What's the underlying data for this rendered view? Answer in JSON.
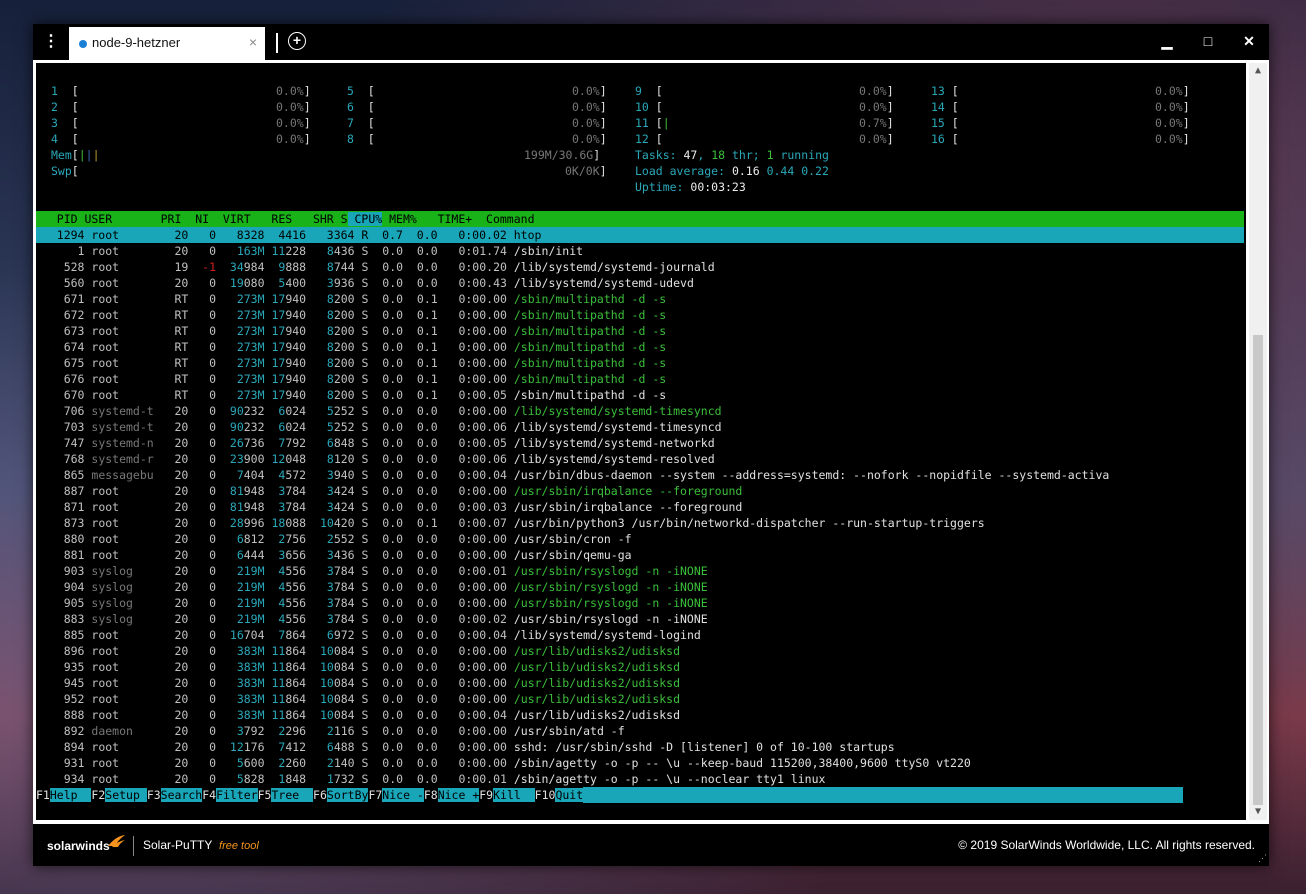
{
  "tab": {
    "title": "node-9-hetzner",
    "close": "×"
  },
  "controls": {
    "menu": "⋮",
    "add": "+",
    "minimize": "▁",
    "maximize": "□",
    "close": "✕"
  },
  "meters": [
    [
      "1 [",
      "0.0%]",
      "5 [",
      "0.0%]",
      "9 [",
      "0.0%]",
      "13 [",
      "0.0%]"
    ],
    [
      "2 [",
      "0.0%]",
      "6 [",
      "0.0%]",
      "10 [",
      "0.0%]",
      "14 [",
      "0.0%]"
    ],
    [
      "3 [",
      "0.0%]",
      "7 [",
      "0.0%]",
      "11 [|",
      "0.7%]",
      "15 [",
      "0.0%]"
    ],
    [
      "4 [",
      "0.0%]",
      "8 [",
      "0.0%]",
      "12 [",
      "0.0%]",
      "16 [",
      "0.0%]"
    ]
  ],
  "mem": {
    "label": "Mem[",
    "bars": "|||",
    "value": "199M/30.6G]"
  },
  "swp": {
    "label": "Swp[",
    "value": "0K/0K]"
  },
  "tasks": {
    "label": "Tasks: ",
    "count": "47",
    "sep": ", ",
    "thr": "18",
    "thr_label": " thr; ",
    "running": "1",
    "running_label": " running"
  },
  "load": {
    "label": "Load average: ",
    "l1": "0.16",
    "l5": "0.44",
    "l15": "0.22"
  },
  "uptime": {
    "label": "Uptime: ",
    "value": "00:03:23"
  },
  "columns": {
    "pid": "  PID",
    "user": " USER     ",
    "pri": "  PRI",
    "ni": "  NI",
    "virt": "  VIRT",
    "res": "   RES",
    "shr": "   SHR",
    "s": " S",
    "cpu": " CPU%",
    "mem": " MEM%",
    "time": "   TIME+ ",
    "cmd": " Command"
  },
  "processes": [
    {
      "pid": "1294",
      "user": "root",
      "pri": "20",
      "ni": "0",
      "virt": "8328",
      "res": "4416",
      "shr": "3364",
      "s": "R",
      "cpu": "0.7",
      "mem": "0.0",
      "time": "0:00.02",
      "cmd": "htop",
      "sel": true
    },
    {
      "pid": "1",
      "user": "root",
      "pri": "20",
      "ni": "0",
      "virt": "163M",
      "res": "11228",
      "shr": "8436",
      "s": "S",
      "cpu": "0.0",
      "mem": "0.0",
      "time": "0:01.74",
      "cmd": "/sbin/init"
    },
    {
      "pid": "528",
      "user": "root",
      "pri": "19",
      "ni": "-1",
      "virt": "34984",
      "res": "9888",
      "shr": "8744",
      "s": "S",
      "cpu": "0.0",
      "mem": "0.0",
      "time": "0:00.20",
      "cmd": "/lib/systemd/systemd-journald"
    },
    {
      "pid": "560",
      "user": "root",
      "pri": "20",
      "ni": "0",
      "virt": "19080",
      "res": "5400",
      "shr": "3936",
      "s": "S",
      "cpu": "0.0",
      "mem": "0.0",
      "time": "0:00.43",
      "cmd": "/lib/systemd/systemd-udevd"
    },
    {
      "pid": "671",
      "user": "root",
      "pri": "RT",
      "ni": "0",
      "virt": "273M",
      "res": "17940",
      "shr": "8200",
      "s": "S",
      "cpu": "0.0",
      "mem": "0.1",
      "time": "0:00.00",
      "cmd": "/sbin/multipathd -d -s",
      "thread": true
    },
    {
      "pid": "672",
      "user": "root",
      "pri": "RT",
      "ni": "0",
      "virt": "273M",
      "res": "17940",
      "shr": "8200",
      "s": "S",
      "cpu": "0.0",
      "mem": "0.1",
      "time": "0:00.00",
      "cmd": "/sbin/multipathd -d -s",
      "thread": true
    },
    {
      "pid": "673",
      "user": "root",
      "pri": "RT",
      "ni": "0",
      "virt": "273M",
      "res": "17940",
      "shr": "8200",
      "s": "S",
      "cpu": "0.0",
      "mem": "0.1",
      "time": "0:00.00",
      "cmd": "/sbin/multipathd -d -s",
      "thread": true
    },
    {
      "pid": "674",
      "user": "root",
      "pri": "RT",
      "ni": "0",
      "virt": "273M",
      "res": "17940",
      "shr": "8200",
      "s": "S",
      "cpu": "0.0",
      "mem": "0.1",
      "time": "0:00.00",
      "cmd": "/sbin/multipathd -d -s",
      "thread": true
    },
    {
      "pid": "675",
      "user": "root",
      "pri": "RT",
      "ni": "0",
      "virt": "273M",
      "res": "17940",
      "shr": "8200",
      "s": "S",
      "cpu": "0.0",
      "mem": "0.1",
      "time": "0:00.00",
      "cmd": "/sbin/multipathd -d -s",
      "thread": true
    },
    {
      "pid": "676",
      "user": "root",
      "pri": "RT",
      "ni": "0",
      "virt": "273M",
      "res": "17940",
      "shr": "8200",
      "s": "S",
      "cpu": "0.0",
      "mem": "0.1",
      "time": "0:00.00",
      "cmd": "/sbin/multipathd -d -s",
      "thread": true
    },
    {
      "pid": "670",
      "user": "root",
      "pri": "RT",
      "ni": "0",
      "virt": "273M",
      "res": "17940",
      "shr": "8200",
      "s": "S",
      "cpu": "0.0",
      "mem": "0.1",
      "time": "0:00.05",
      "cmd": "/sbin/multipathd -d -s"
    },
    {
      "pid": "706",
      "user": "systemd-t",
      "pri": "20",
      "ni": "0",
      "virt": "90232",
      "res": "6024",
      "shr": "5252",
      "s": "S",
      "cpu": "0.0",
      "mem": "0.0",
      "time": "0:00.00",
      "cmd": "/lib/systemd/systemd-timesyncd",
      "thread": true,
      "dimuser": true
    },
    {
      "pid": "703",
      "user": "systemd-t",
      "pri": "20",
      "ni": "0",
      "virt": "90232",
      "res": "6024",
      "shr": "5252",
      "s": "S",
      "cpu": "0.0",
      "mem": "0.0",
      "time": "0:00.06",
      "cmd": "/lib/systemd/systemd-timesyncd",
      "dimuser": true
    },
    {
      "pid": "747",
      "user": "systemd-n",
      "pri": "20",
      "ni": "0",
      "virt": "26736",
      "res": "7792",
      "shr": "6848",
      "s": "S",
      "cpu": "0.0",
      "mem": "0.0",
      "time": "0:00.05",
      "cmd": "/lib/systemd/systemd-networkd",
      "dimuser": true
    },
    {
      "pid": "768",
      "user": "systemd-r",
      "pri": "20",
      "ni": "0",
      "virt": "23900",
      "res": "12048",
      "shr": "8120",
      "s": "S",
      "cpu": "0.0",
      "mem": "0.0",
      "time": "0:00.06",
      "cmd": "/lib/systemd/systemd-resolved",
      "dimuser": true
    },
    {
      "pid": "865",
      "user": "messagebu",
      "pri": "20",
      "ni": "0",
      "virt": "7404",
      "res": "4572",
      "shr": "3940",
      "s": "S",
      "cpu": "0.0",
      "mem": "0.0",
      "time": "0:00.04",
      "cmd": "/usr/bin/dbus-daemon --system --address=systemd: --nofork --nopidfile --systemd-activa",
      "dimuser": true
    },
    {
      "pid": "887",
      "user": "root",
      "pri": "20",
      "ni": "0",
      "virt": "81948",
      "res": "3784",
      "shr": "3424",
      "s": "S",
      "cpu": "0.0",
      "mem": "0.0",
      "time": "0:00.00",
      "cmd": "/usr/sbin/irqbalance --foreground",
      "thread": true
    },
    {
      "pid": "871",
      "user": "root",
      "pri": "20",
      "ni": "0",
      "virt": "81948",
      "res": "3784",
      "shr": "3424",
      "s": "S",
      "cpu": "0.0",
      "mem": "0.0",
      "time": "0:00.03",
      "cmd": "/usr/sbin/irqbalance --foreground"
    },
    {
      "pid": "873",
      "user": "root",
      "pri": "20",
      "ni": "0",
      "virt": "28996",
      "res": "18088",
      "shr": "10420",
      "s": "S",
      "cpu": "0.0",
      "mem": "0.1",
      "time": "0:00.07",
      "cmd": "/usr/bin/python3 /usr/bin/networkd-dispatcher --run-startup-triggers"
    },
    {
      "pid": "880",
      "user": "root",
      "pri": "20",
      "ni": "0",
      "virt": "6812",
      "res": "2756",
      "shr": "2552",
      "s": "S",
      "cpu": "0.0",
      "mem": "0.0",
      "time": "0:00.00",
      "cmd": "/usr/sbin/cron -f"
    },
    {
      "pid": "881",
      "user": "root",
      "pri": "20",
      "ni": "0",
      "virt": "6444",
      "res": "3656",
      "shr": "3436",
      "s": "S",
      "cpu": "0.0",
      "mem": "0.0",
      "time": "0:00.00",
      "cmd": "/usr/sbin/qemu-ga"
    },
    {
      "pid": "903",
      "user": "syslog",
      "pri": "20",
      "ni": "0",
      "virt": "219M",
      "res": "4556",
      "shr": "3784",
      "s": "S",
      "cpu": "0.0",
      "mem": "0.0",
      "time": "0:00.01",
      "cmd": "/usr/sbin/rsyslogd -n -iNONE",
      "thread": true,
      "dimuser": true
    },
    {
      "pid": "904",
      "user": "syslog",
      "pri": "20",
      "ni": "0",
      "virt": "219M",
      "res": "4556",
      "shr": "3784",
      "s": "S",
      "cpu": "0.0",
      "mem": "0.0",
      "time": "0:00.00",
      "cmd": "/usr/sbin/rsyslogd -n -iNONE",
      "thread": true,
      "dimuser": true
    },
    {
      "pid": "905",
      "user": "syslog",
      "pri": "20",
      "ni": "0",
      "virt": "219M",
      "res": "4556",
      "shr": "3784",
      "s": "S",
      "cpu": "0.0",
      "mem": "0.0",
      "time": "0:00.00",
      "cmd": "/usr/sbin/rsyslogd -n -iNONE",
      "thread": true,
      "dimuser": true
    },
    {
      "pid": "883",
      "user": "syslog",
      "pri": "20",
      "ni": "0",
      "virt": "219M",
      "res": "4556",
      "shr": "3784",
      "s": "S",
      "cpu": "0.0",
      "mem": "0.0",
      "time": "0:00.02",
      "cmd": "/usr/sbin/rsyslogd -n -iNONE",
      "dimuser": true
    },
    {
      "pid": "885",
      "user": "root",
      "pri": "20",
      "ni": "0",
      "virt": "16704",
      "res": "7864",
      "shr": "6972",
      "s": "S",
      "cpu": "0.0",
      "mem": "0.0",
      "time": "0:00.04",
      "cmd": "/lib/systemd/systemd-logind"
    },
    {
      "pid": "896",
      "user": "root",
      "pri": "20",
      "ni": "0",
      "virt": "383M",
      "res": "11864",
      "shr": "10084",
      "s": "S",
      "cpu": "0.0",
      "mem": "0.0",
      "time": "0:00.00",
      "cmd": "/usr/lib/udisks2/udisksd",
      "thread": true
    },
    {
      "pid": "935",
      "user": "root",
      "pri": "20",
      "ni": "0",
      "virt": "383M",
      "res": "11864",
      "shr": "10084",
      "s": "S",
      "cpu": "0.0",
      "mem": "0.0",
      "time": "0:00.00",
      "cmd": "/usr/lib/udisks2/udisksd",
      "thread": true
    },
    {
      "pid": "945",
      "user": "root",
      "pri": "20",
      "ni": "0",
      "virt": "383M",
      "res": "11864",
      "shr": "10084",
      "s": "S",
      "cpu": "0.0",
      "mem": "0.0",
      "time": "0:00.00",
      "cmd": "/usr/lib/udisks2/udisksd",
      "thread": true
    },
    {
      "pid": "952",
      "user": "root",
      "pri": "20",
      "ni": "0",
      "virt": "383M",
      "res": "11864",
      "shr": "10084",
      "s": "S",
      "cpu": "0.0",
      "mem": "0.0",
      "time": "0:00.00",
      "cmd": "/usr/lib/udisks2/udisksd",
      "thread": true
    },
    {
      "pid": "888",
      "user": "root",
      "pri": "20",
      "ni": "0",
      "virt": "383M",
      "res": "11864",
      "shr": "10084",
      "s": "S",
      "cpu": "0.0",
      "mem": "0.0",
      "time": "0:00.04",
      "cmd": "/usr/lib/udisks2/udisksd"
    },
    {
      "pid": "892",
      "user": "daemon",
      "pri": "20",
      "ni": "0",
      "virt": "3792",
      "res": "2296",
      "shr": "2116",
      "s": "S",
      "cpu": "0.0",
      "mem": "0.0",
      "time": "0:00.00",
      "cmd": "/usr/sbin/atd -f",
      "dimuser": true
    },
    {
      "pid": "894",
      "user": "root",
      "pri": "20",
      "ni": "0",
      "virt": "12176",
      "res": "7412",
      "shr": "6488",
      "s": "S",
      "cpu": "0.0",
      "mem": "0.0",
      "time": "0:00.00",
      "cmd": "sshd: /usr/sbin/sshd -D [listener] 0 of 10-100 startups"
    },
    {
      "pid": "931",
      "user": "root",
      "pri": "20",
      "ni": "0",
      "virt": "5600",
      "res": "2260",
      "shr": "2140",
      "s": "S",
      "cpu": "0.0",
      "mem": "0.0",
      "time": "0:00.00",
      "cmd": "/sbin/agetty -o -p -- \\u --keep-baud 115200,38400,9600 ttyS0 vt220"
    },
    {
      "pid": "934",
      "user": "root",
      "pri": "20",
      "ni": "0",
      "virt": "5828",
      "res": "1848",
      "shr": "1732",
      "s": "S",
      "cpu": "0.0",
      "mem": "0.0",
      "time": "0:00.01",
      "cmd": "/sbin/agetty -o -p -- \\u --noclear tty1 linux"
    }
  ],
  "fkeys": [
    {
      "key": "F1",
      "label": "Help  "
    },
    {
      "key": "F2",
      "label": "Setup "
    },
    {
      "key": "F3",
      "label": "Search"
    },
    {
      "key": "F4",
      "label": "Filter"
    },
    {
      "key": "F5",
      "label": "Tree  "
    },
    {
      "key": "F6",
      "label": "SortBy"
    },
    {
      "key": "F7",
      "label": "Nice -"
    },
    {
      "key": "F8",
      "label": "Nice +"
    },
    {
      "key": "F9",
      "label": "Kill  "
    },
    {
      "key": "F10",
      "label": "Quit"
    }
  ],
  "footer": {
    "logo": "solarwinds",
    "product": "Solar-PuTTY",
    "tag": "free tool",
    "copyright": "© 2019 SolarWinds Worldwide, LLC. All rights reserved."
  },
  "colors": {
    "header_green": "#19b319",
    "select_cyan": "#19a6b8",
    "accent_orange": "#f7941d",
    "tab_dot": "#1c7fd6"
  }
}
